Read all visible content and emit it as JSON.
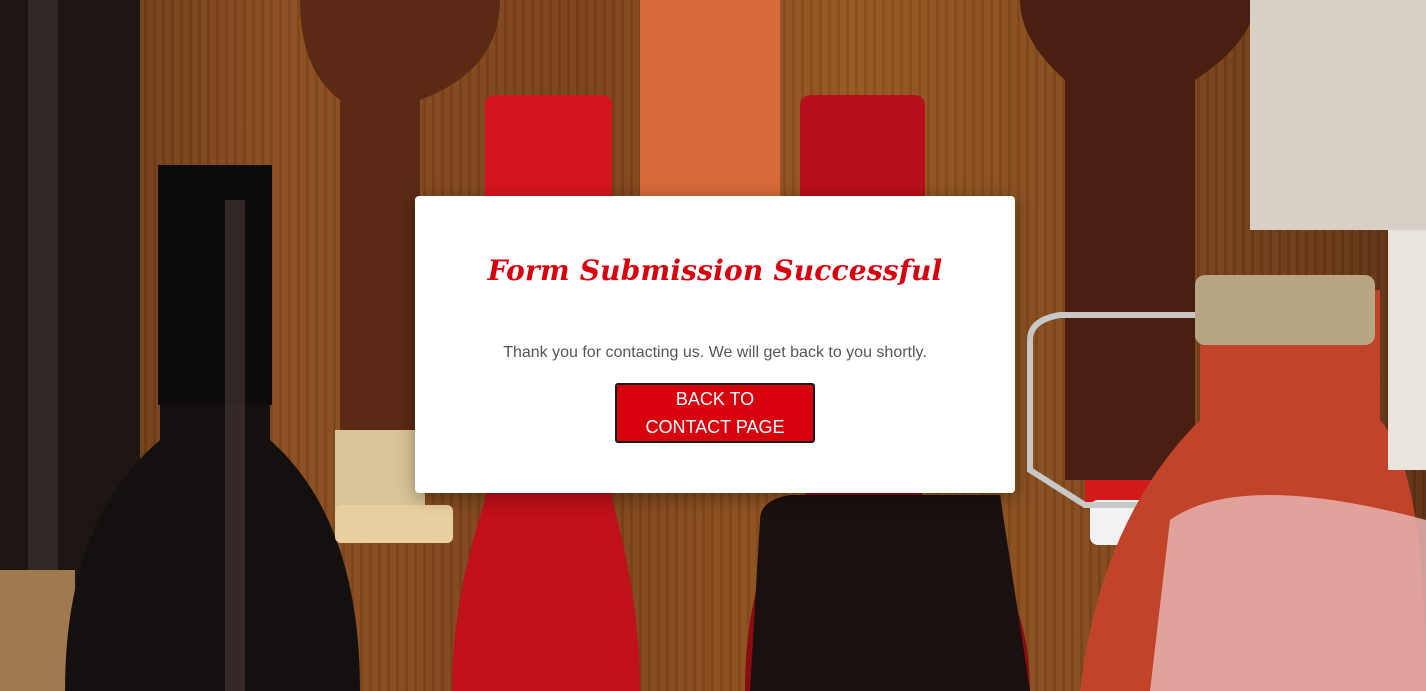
{
  "modal": {
    "title": "Form Submission Successful",
    "message": "Thank you for contacting us. We will get back to you shortly.",
    "back_button_label": "BACK TO CONTACT PAGE"
  },
  "background": {
    "description_icon": "wine-bottles-photo"
  },
  "colors": {
    "accent": "#d9000d",
    "message_text": "#555555",
    "modal_bg": "#ffffff"
  }
}
